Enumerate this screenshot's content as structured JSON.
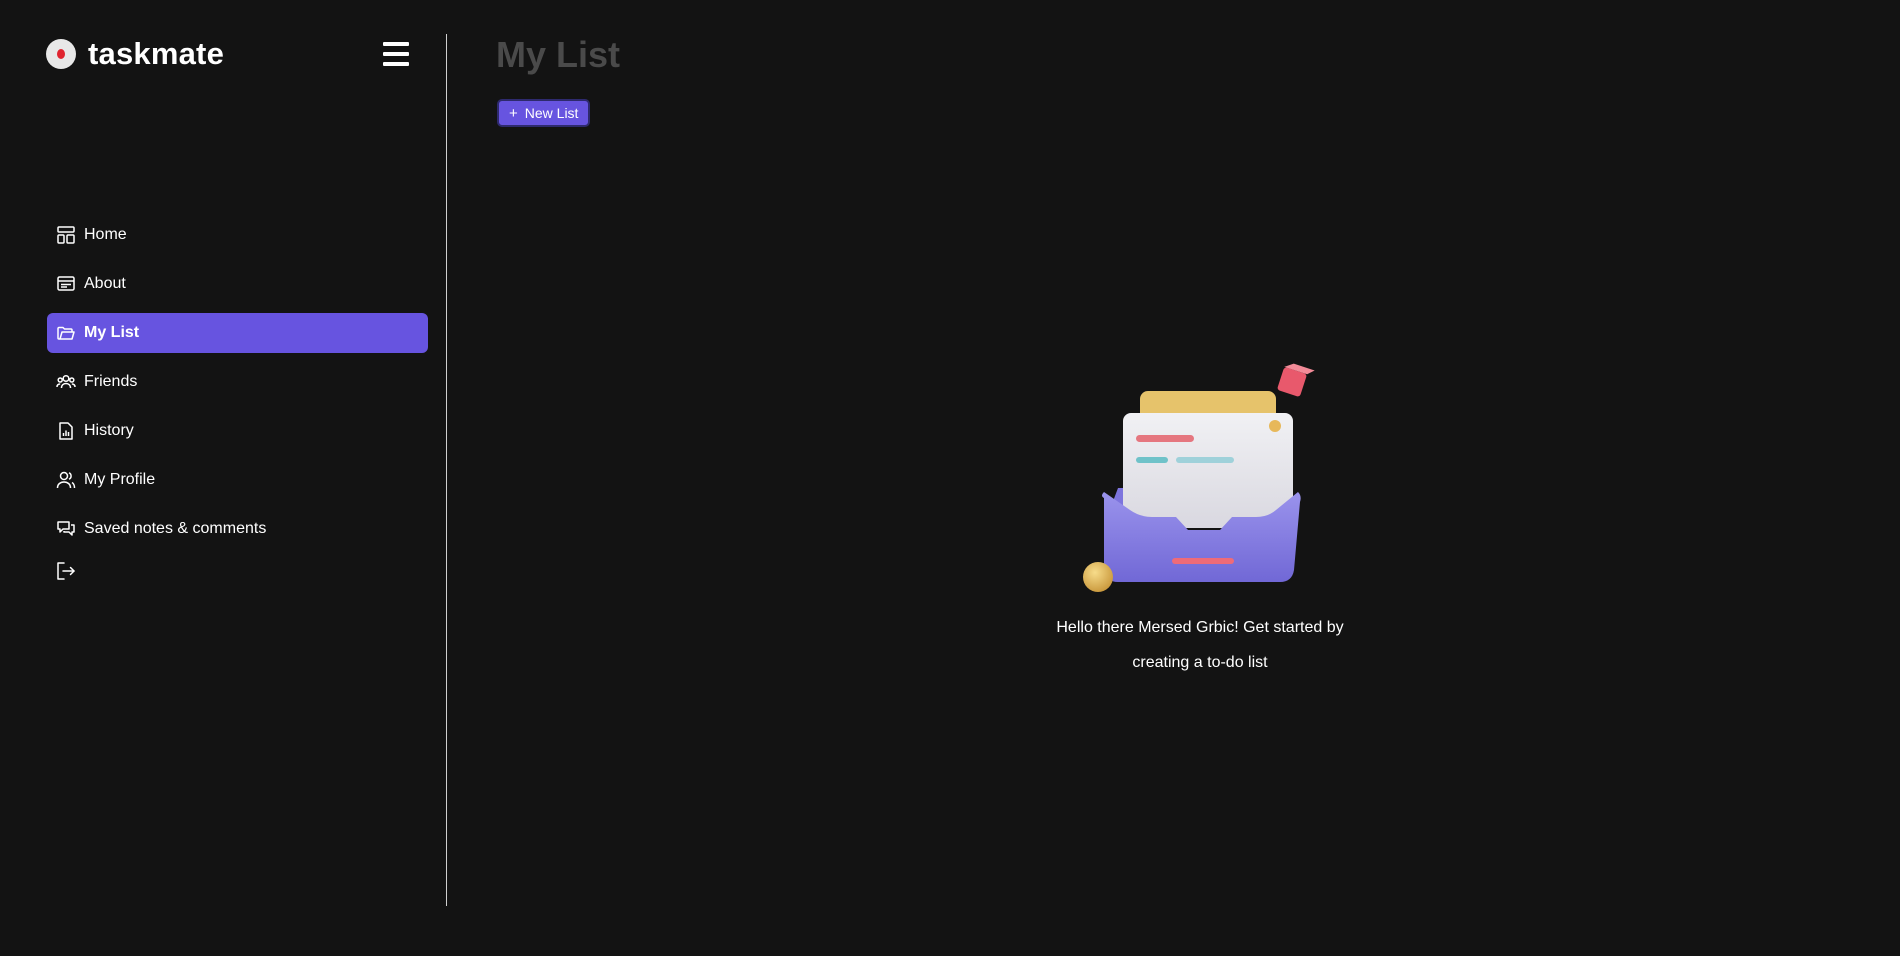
{
  "brand": {
    "name": "taskmate",
    "logo_icon": "record-dot-icon"
  },
  "header": {
    "menu_icon": "hamburger-menu-icon"
  },
  "sidebar": {
    "items": [
      {
        "label": "Home",
        "icon": "layout-dashboard-icon",
        "active": false
      },
      {
        "label": "About",
        "icon": "id-card-icon",
        "active": false
      },
      {
        "label": "My List",
        "icon": "folder-open-icon",
        "active": true
      },
      {
        "label": "Friends",
        "icon": "users-icon",
        "active": false
      },
      {
        "label": "History",
        "icon": "file-chart-icon",
        "active": false
      },
      {
        "label": "My Profile",
        "icon": "user-profile-icon",
        "active": false
      },
      {
        "label": "Saved notes & comments",
        "icon": "chat-bubbles-icon",
        "active": false
      }
    ],
    "logout_icon": "logout-icon"
  },
  "main": {
    "title": "My List",
    "new_list_label": "New List",
    "empty_message_line1": "Hello there Mersed Grbic! Get started by",
    "empty_message_line2": "creating a to-do list"
  },
  "colors": {
    "background": "#131313",
    "accent": "#6754e0",
    "title_gray": "#4a4a4a"
  }
}
